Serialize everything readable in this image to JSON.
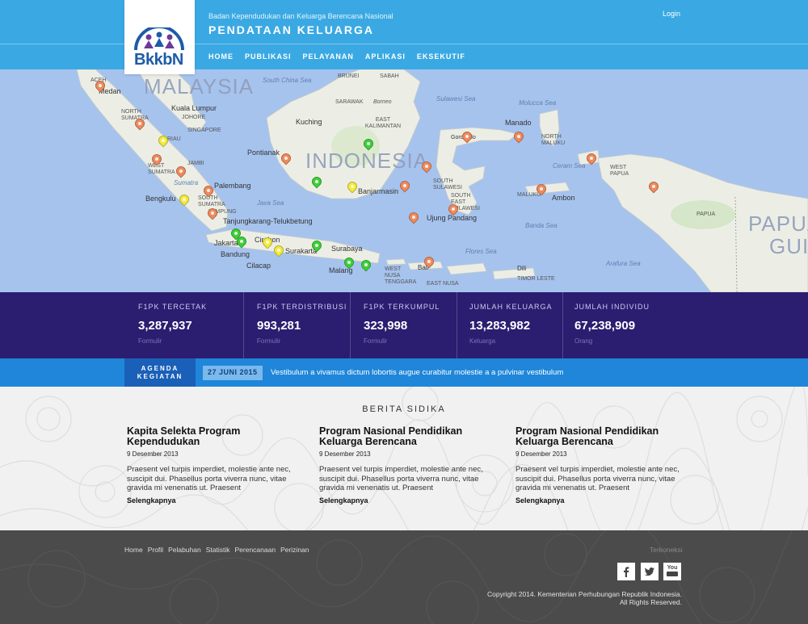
{
  "header": {
    "logo_text": "BkkbN",
    "org_name": "Badan Kependudukan dan Keluarga Berencana Nasional",
    "site_title": "PENDATAAN KELUARGA",
    "login_label": "Login",
    "nav": [
      "HOME",
      "PUBLIKASI",
      "PELAYANAN",
      "APLIKASI",
      "EKSEKUTIF"
    ]
  },
  "map": {
    "countries": [
      "MALAYSIA",
      "INDONESIA",
      "PAPUA",
      "GUI"
    ],
    "seas": [
      "South China Sea",
      "Sulawesi Sea",
      "Molucca Sea",
      "Java Sea",
      "Banda Sea",
      "Flores Sea",
      "Arafura Sea",
      "Ceram Sea",
      "Sumatra"
    ],
    "cities": [
      "Medan",
      "Kuala Lumpur",
      "Kuching",
      "Pontianak",
      "Palembang",
      "Bengkulu",
      "Tanjungkarang-Telukbetung",
      "Jakarta",
      "Bandung",
      "Cirebon",
      "Cilacap",
      "Surakarta",
      "Surabaya",
      "Malang",
      "Banjarmasin",
      "Ujung Pandang",
      "Manado",
      "Gorontalo",
      "Ambon",
      "Dili",
      "Bali"
    ],
    "provinces": [
      "ACEH",
      "NORTH SUMATRA",
      "JOHORE",
      "SINGAPORE",
      "RIAU",
      "JAMBI",
      "WEST SUMATRA",
      "SOUTH SUMATRA",
      "LAMPUNG",
      "BRUNEI",
      "SABAH",
      "SARAWAK",
      "Borneo",
      "EAST KALIMANTAN",
      "SOUTH SULAWESI",
      "SOUTH EAST SULAWESI",
      "NORTH MALUKU",
      "MALUKU",
      "WEST PAPUA",
      "PAPUA",
      "WEST NUSA TENGGARA",
      "EAST NUSA",
      "TIMOR LESTE"
    ],
    "marker_colors": {
      "orange": "#f08a5c",
      "yellow": "#f3ea3c",
      "green": "#3fcf3a"
    }
  },
  "stats": [
    {
      "label": "F1PK TERCETAK",
      "value": "3,287,937",
      "unit": "Formulir"
    },
    {
      "label": "F1PK TERDISTRIBUSI",
      "value": "993,281",
      "unit": "Formulir"
    },
    {
      "label": "F1PK TERKUMPUL",
      "value": "323,998",
      "unit": "Formulir"
    },
    {
      "label": "JUMLAH KELUARGA",
      "value": "13,283,982",
      "unit": "Keluarga"
    },
    {
      "label": "JUMLAH INDIVIDU",
      "value": "67,238,909",
      "unit": "Orang"
    }
  ],
  "agenda": {
    "label_line1": "AGENDA",
    "label_line2": "KEGIATAN",
    "date": "27 JUNI 2015",
    "text": "Vestibulum a vivamus dictum lobortis augue curabitur molestie a a pulvinar vestibulum"
  },
  "news": {
    "title": "BERITA SIDIKA",
    "articles": [
      {
        "title": "Kapita Selekta Program Kependudukan",
        "date": "9 Desember 2013",
        "excerpt": "Praesent vel turpis imperdiet, molestie ante nec, suscipit dui. Phasellus porta viverra nunc, vitae gravida mi venenatis ut. Praesent",
        "more": "Selengkapnya"
      },
      {
        "title": "Program Nasional Pendidikan Keluarga Berencana",
        "date": "9 Desember 2013",
        "excerpt": "Praesent vel turpis imperdiet, molestie ante nec, suscipit dui. Phasellus porta viverra nunc, vitae gravida mi venenatis ut. Praesent",
        "more": "Selengkapnya"
      },
      {
        "title": "Program Nasional Pendidikan Keluarga Berencana",
        "date": "9 Desember 2013",
        "excerpt": "Praesent vel turpis imperdiet, molestie ante nec, suscipit dui. Phasellus porta viverra nunc, vitae gravida mi venenatis ut. Praesent",
        "more": "Selengkapnya"
      }
    ]
  },
  "footer": {
    "links": [
      "Home",
      "Profil",
      "Pelabuhan",
      "Statistik",
      "Perencanaan",
      "Perizinan"
    ],
    "connect_label": "Terkoneksi",
    "social": [
      "facebook-icon",
      "twitter-icon",
      "youtube-icon"
    ],
    "youtube_label": "You",
    "copyright_line1": "Copyright 2014. Kementerian Perhubungan Republik Indonesia.",
    "copyright_line2": "All Rights Reserved."
  }
}
